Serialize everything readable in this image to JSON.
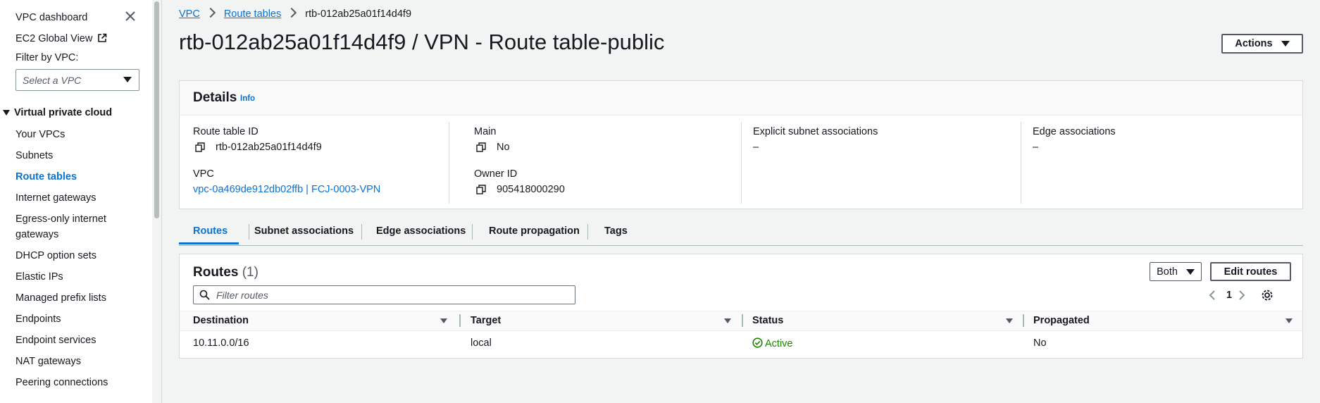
{
  "sidebar": {
    "dashboard": "VPC dashboard",
    "global_view": "EC2 Global View",
    "filter_label": "Filter by VPC:",
    "filter_placeholder": "Select a VPC",
    "section": "Virtual private cloud",
    "items": [
      {
        "label": "Your VPCs"
      },
      {
        "label": "Subnets"
      },
      {
        "label": "Route tables"
      },
      {
        "label": "Internet gateways"
      },
      {
        "label": "Egress-only internet"
      },
      {
        "label": "gateways"
      },
      {
        "label": "DHCP option sets"
      },
      {
        "label": "Elastic IPs"
      },
      {
        "label": "Managed prefix lists"
      },
      {
        "label": "Endpoints"
      },
      {
        "label": "Endpoint services"
      },
      {
        "label": "NAT gateways"
      },
      {
        "label": "Peering connections"
      }
    ]
  },
  "breadcrumb": {
    "root": "VPC",
    "parent": "Route tables",
    "current": "rtb-012ab25a01f14d4f9"
  },
  "page_title": "rtb-012ab25a01f14d4f9 / VPN - Route table-public",
  "actions_label": "Actions",
  "details": {
    "title": "Details",
    "info": "Info",
    "route_table_id_label": "Route table ID",
    "route_table_id": "rtb-012ab25a01f14d4f9",
    "main_label": "Main",
    "main_value": "No",
    "explicit_label": "Explicit subnet associations",
    "explicit_value": "–",
    "edge_label": "Edge associations",
    "edge_value": "–",
    "vpc_label": "VPC",
    "vpc_value": "vpc-0a469de912db02ffb | FCJ-0003-VPN",
    "owner_label": "Owner ID",
    "owner_value": "905418000290"
  },
  "tabs": [
    {
      "label": "Routes"
    },
    {
      "label": "Subnet associations"
    },
    {
      "label": "Edge associations"
    },
    {
      "label": "Route propagation"
    },
    {
      "label": "Tags"
    }
  ],
  "routes": {
    "title": "Routes",
    "count": "(1)",
    "both_label": "Both",
    "edit_label": "Edit routes",
    "filter_placeholder": "Filter routes",
    "page": "1",
    "columns": [
      "Destination",
      "Target",
      "Status",
      "Propagated"
    ],
    "rows": [
      {
        "destination": "10.11.0.0/16",
        "target": "local",
        "status": "Active",
        "propagated": "No"
      }
    ]
  },
  "colors": {
    "link": "#0972d3",
    "status_active": "#1d8102",
    "background": "#f2f3f3"
  }
}
